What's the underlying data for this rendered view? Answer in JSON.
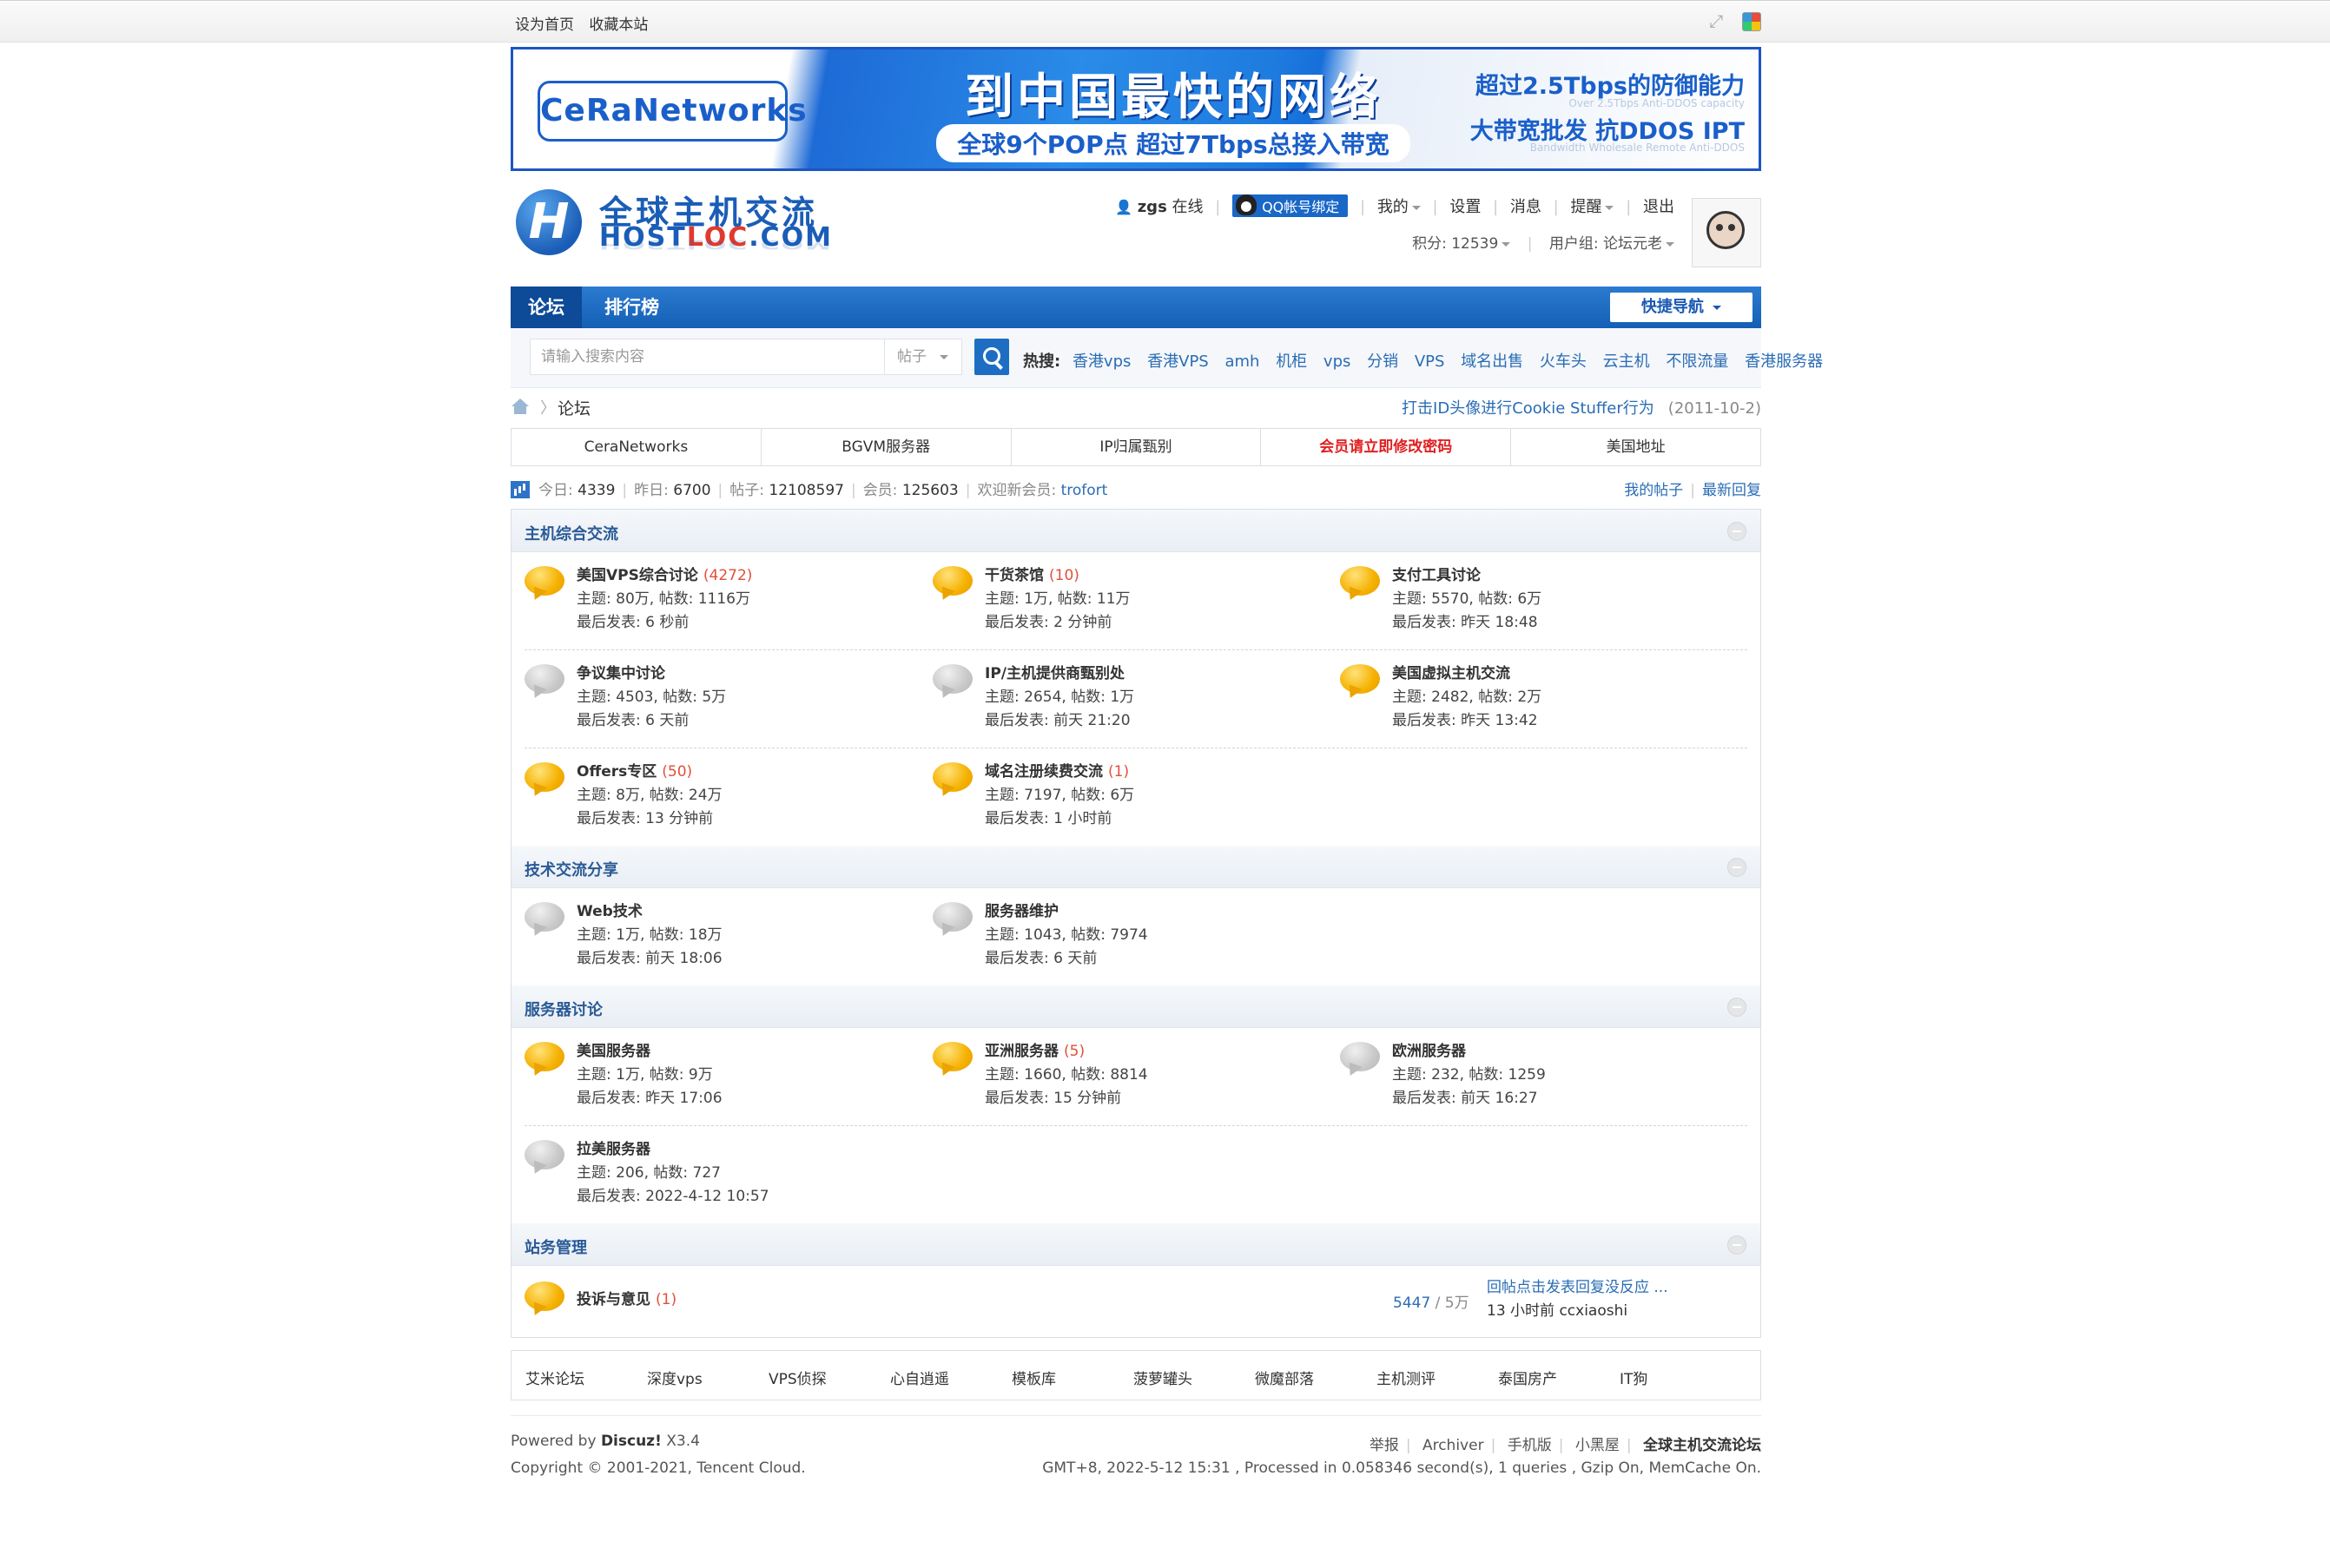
{
  "topbar": {
    "set_home": "设为首页",
    "bookmark": "收藏本站",
    "expand_icon": "expand-icon",
    "style_icon": "style-switch-icon"
  },
  "banner": {
    "brand": "CeRaNetworks",
    "headline": "到中国最快的网络",
    "subline": "全球9个POP点  超过7Tbps总接入带宽",
    "right_line1": "超过2.5Tbps的防御能力",
    "right_line1_small": "Over 2.5Tbps Anti-DDOS capacity",
    "right_line2": "大带宽批发  抗DDOS IPT",
    "right_line2_small": "Bandwidth Wholesale  Remote Anti-DDOS"
  },
  "logo": {
    "cn": "全球主机交流",
    "en_prefix": "HOST",
    "en_mid": "LOC",
    "en_suffix": ".COM"
  },
  "user": {
    "name": "zgs",
    "online": "在线",
    "qq_bind": "QQ帐号绑定",
    "menu": [
      "我的",
      "设置",
      "消息",
      "提醒",
      "退出"
    ],
    "credits": "积分: 12539",
    "group": "用户组: 论坛元老"
  },
  "nav": {
    "items": [
      "论坛",
      "排行榜"
    ],
    "quick": "快捷导航"
  },
  "search": {
    "placeholder": "请输入搜索内容",
    "type": "帖子",
    "hot_label": "热搜:",
    "hot": [
      "香港vps",
      "香港VPS",
      "amh",
      "机柜",
      "vps",
      "分销",
      "VPS",
      "域名出售",
      "火车头",
      "云主机",
      "不限流量",
      "香港服务器"
    ]
  },
  "breadcrumb": {
    "current": "论坛",
    "notice": "打击ID头像进行Cookie Stuffer行为",
    "notice_date": "(2011-10-2)"
  },
  "links": [
    "CeraNetworks",
    "BGVM服务器",
    "IP归属甄别",
    "会员请立即修改密码",
    "美国地址"
  ],
  "stats": {
    "today": "今日: ",
    "today_v": "4339",
    "yesterday": "昨日: ",
    "yesterday_v": "6700",
    "posts": "帖子: ",
    "posts_v": "12108597",
    "members": "会员: ",
    "members_v": "125603",
    "welcome": "欢迎新会员: ",
    "newest": "trofort",
    "my_posts": "我的帖子",
    "latest": "最新回复"
  },
  "categories": [
    {
      "title": "主机综合交流",
      "rows": [
        [
          {
            "name": "美国VPS综合讨论",
            "today": "(4272)",
            "stats": "主题: 80万, 帖数: 1116万",
            "last": "最后发表: 6 秒前",
            "new": true
          },
          {
            "name": "干货茶馆",
            "today": "(10)",
            "stats": "主题: 1万, 帖数: 11万",
            "last": "最后发表: 2 分钟前",
            "new": true
          },
          {
            "name": "支付工具讨论",
            "today": "",
            "stats": "主题: 5570, 帖数: 6万",
            "last": "最后发表: 昨天 18:48",
            "new": true
          }
        ],
        [
          {
            "name": "争议集中讨论",
            "today": "",
            "stats": "主题: 4503, 帖数: 5万",
            "last": "最后发表: 6 天前",
            "new": false
          },
          {
            "name": "IP/主机提供商甄别处",
            "today": "",
            "stats": "主题: 2654, 帖数: 1万",
            "last": "最后发表: 前天 21:20",
            "new": false
          },
          {
            "name": "美国虚拟主机交流",
            "today": "",
            "stats": "主题: 2482, 帖数: 2万",
            "last": "最后发表: 昨天 13:42",
            "new": true
          }
        ],
        [
          {
            "name": "Offers专区",
            "today": "(50)",
            "stats": "主题: 8万, 帖数: 24万",
            "last": "最后发表: 13 分钟前",
            "new": true
          },
          {
            "name": "域名注册续费交流",
            "today": "(1)",
            "stats": "主题: 7197, 帖数: 6万",
            "last": "最后发表: 1 小时前",
            "new": true
          }
        ]
      ]
    },
    {
      "title": "技术交流分享",
      "rows": [
        [
          {
            "name": "Web技术",
            "today": "",
            "stats": "主题: 1万, 帖数: 18万",
            "last": "最后发表: 前天 18:06",
            "new": false
          },
          {
            "name": "服务器维护",
            "today": "",
            "stats": "主题: 1043, 帖数: 7974",
            "last": "最后发表: 6 天前",
            "new": false
          }
        ]
      ]
    },
    {
      "title": "服务器讨论",
      "rows": [
        [
          {
            "name": "美国服务器",
            "today": "",
            "stats": "主题: 1万, 帖数: 9万",
            "last": "最后发表: 昨天 17:06",
            "new": true
          },
          {
            "name": "亚洲服务器",
            "today": "(5)",
            "stats": "主题: 1660, 帖数: 8814",
            "last": "最后发表: 15 分钟前",
            "new": true
          },
          {
            "name": "欧洲服务器",
            "today": "",
            "stats": "主题: 232, 帖数: 1259",
            "last": "最后发表: 前天 16:27",
            "new": false
          }
        ],
        [
          {
            "name": "拉美服务器",
            "today": "",
            "stats": "主题: 206, 帖数: 727",
            "last": "最后发表: 2022-4-12 10:57",
            "new": false
          }
        ]
      ]
    }
  ],
  "admin_cat": {
    "title": "站务管理",
    "name": "投诉与意见",
    "today": "(1)",
    "threads": "5447",
    "posts": " / 5万",
    "last_subject": "回帖点击发表回复没反应 ...",
    "last_meta": "13 小时前 ccxiaoshi"
  },
  "friend_links": [
    "艾米论坛",
    "深度vps",
    "VPS侦探",
    "心自逍遥",
    "模板库",
    "菠萝罐头",
    "微魔部落",
    "主机测评",
    "泰国房产",
    "IT狗"
  ],
  "footer": {
    "powered": "Powered by ",
    "discuz": "Discuz!",
    "version": " X3.4",
    "copyright": "Copyright © 2001-2021, Tencent Cloud.",
    "links": [
      "举报",
      "Archiver",
      "手机版",
      "小黑屋",
      "全球主机交流论坛"
    ],
    "info": "GMT+8, 2022-5-12 15:31 , Processed in 0.058346 second(s), 1 queries , Gzip On, MemCache On."
  }
}
